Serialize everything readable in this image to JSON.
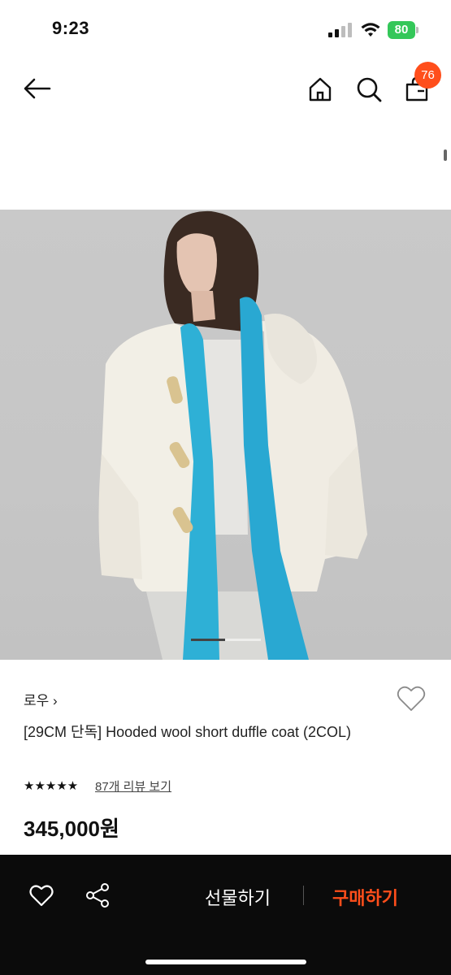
{
  "status_bar": {
    "time": "9:23",
    "battery": "80"
  },
  "header": {
    "cart_count": "76"
  },
  "product": {
    "brand": "로우",
    "title": "[29CM 단독] Hooded wool short duffle coat (2COL)",
    "stars": "★★★★★",
    "review_link": "87개 리뷰 보기",
    "price": "345,000원",
    "rating_value": 5
  },
  "carousel": {
    "total_slides": 2,
    "current_slide": 1
  },
  "bottom_bar": {
    "gift_label": "선물하기",
    "buy_label": "구매하기"
  },
  "colors": {
    "accent": "#ff4e1b",
    "bottom_bar_bg": "#0b0b0b",
    "battery": "#34c759"
  },
  "icons": [
    "back-arrow-icon",
    "home-icon",
    "search-icon",
    "shopping-bag-icon",
    "heart-icon",
    "share-icon",
    "wishlist-heart-icon"
  ]
}
